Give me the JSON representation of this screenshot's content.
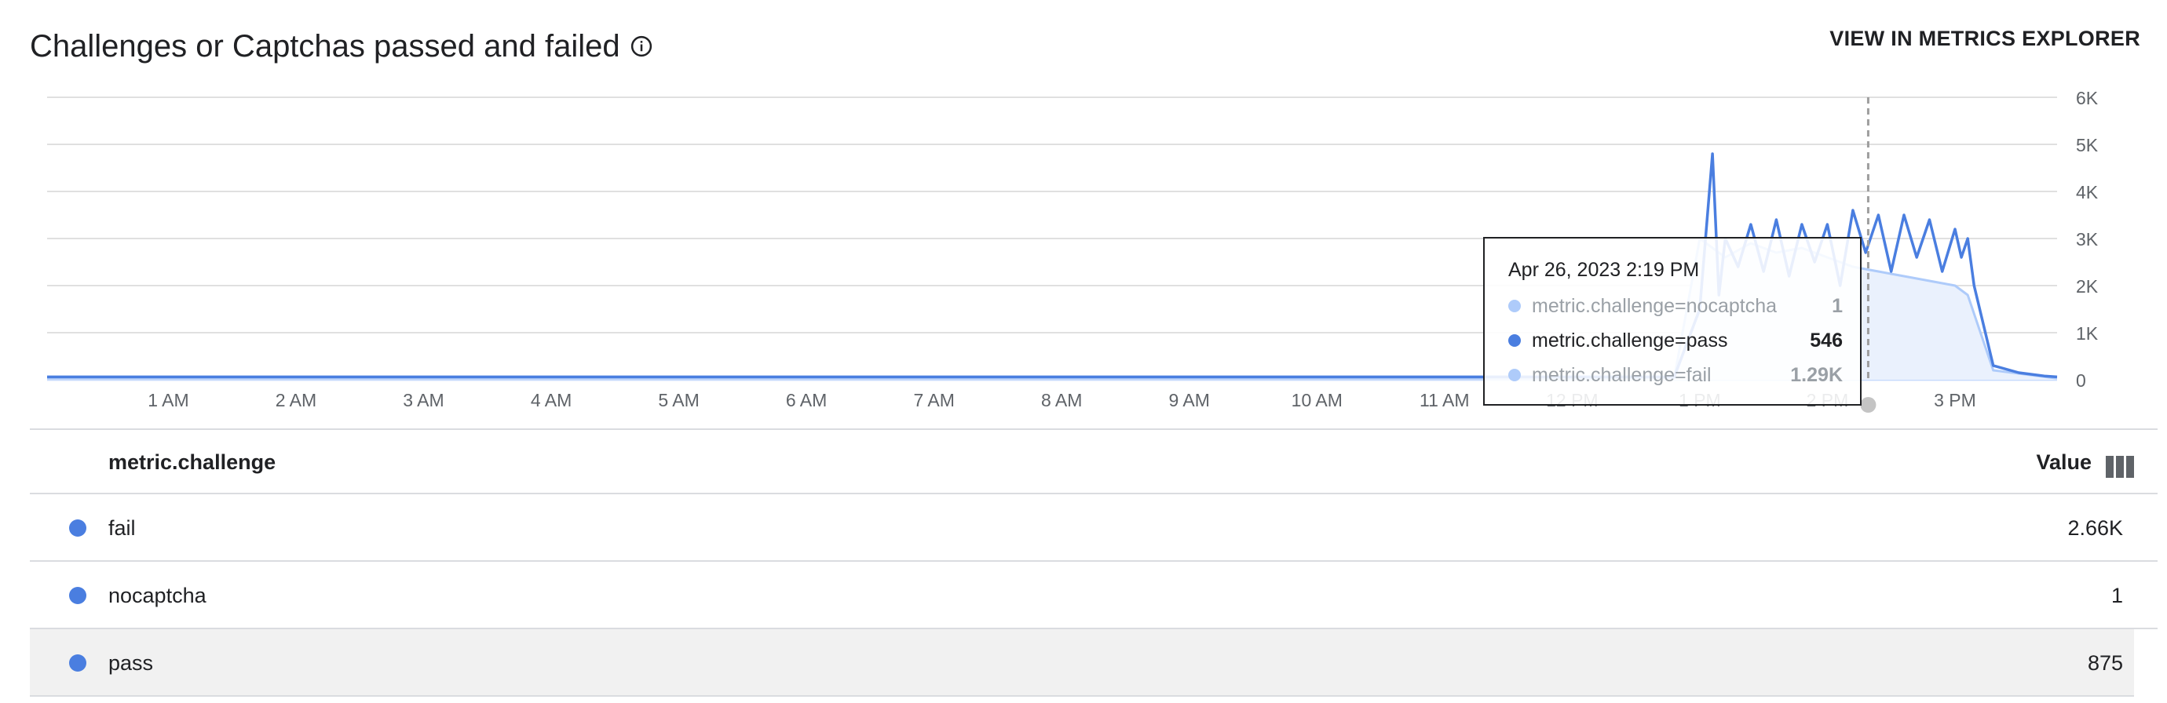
{
  "header": {
    "title": "Challenges or Captchas passed and failed",
    "explorer_link": "VIEW IN METRICS EXPLORER"
  },
  "chart_data": {
    "type": "line",
    "title": "Challenges or Captchas passed and failed",
    "x_ticks": [
      "1 AM",
      "2 AM",
      "3 AM",
      "4 AM",
      "5 AM",
      "6 AM",
      "7 AM",
      "8 AM",
      "9 AM",
      "10 AM",
      "11 AM",
      "12 PM",
      "1 PM",
      "2 PM",
      "3 PM"
    ],
    "y_ticks": [
      "0",
      "1K",
      "2K",
      "3K",
      "4K",
      "5K",
      "6K"
    ],
    "ylim": [
      0,
      6000
    ],
    "xlim_hours": [
      0.05,
      15.8
    ],
    "grid": true,
    "cursor_time_hours": 14.32,
    "series": [
      {
        "name": "metric.challenge=pass",
        "color": "#4a7ee0",
        "x_hours": [
          0.05,
          1,
          2,
          3,
          4,
          5,
          6,
          7,
          8,
          9,
          10,
          11,
          12,
          12.8,
          13.0,
          13.1,
          13.15,
          13.2,
          13.3,
          13.4,
          13.5,
          13.6,
          13.7,
          13.8,
          13.9,
          14.0,
          14.1,
          14.2,
          14.3,
          14.4,
          14.5,
          14.6,
          14.7,
          14.8,
          14.9,
          15.0,
          15.05,
          15.1,
          15.15,
          15.3,
          15.5,
          15.7,
          15.8
        ],
        "values": [
          60,
          60,
          60,
          60,
          60,
          60,
          60,
          60,
          60,
          60,
          60,
          60,
          60,
          60,
          1500,
          4800,
          1800,
          3000,
          2400,
          3300,
          2300,
          3400,
          2200,
          3300,
          2500,
          3300,
          2000,
          3600,
          2700,
          3500,
          2300,
          3500,
          2600,
          3400,
          2300,
          3200,
          2600,
          3000,
          2000,
          300,
          150,
          80,
          60
        ]
      },
      {
        "name": "metric.challenge=fail",
        "color": "#aecbfa",
        "x_hours": [
          0.05,
          12,
          12.8,
          13.0,
          13.2,
          13.4,
          13.6,
          13.8,
          14.0,
          14.2,
          14.4,
          14.6,
          14.8,
          15.0,
          15.1,
          15.3,
          15.8
        ],
        "values": [
          30,
          30,
          40,
          3000,
          2600,
          2900,
          2700,
          2800,
          2600,
          2400,
          2300,
          2200,
          2100,
          2000,
          1800,
          200,
          30
        ]
      },
      {
        "name": "metric.challenge=nocaptcha",
        "color": "#c6dafc",
        "x_hours": [
          0.05,
          15.8
        ],
        "values": [
          1,
          1
        ]
      }
    ]
  },
  "tooltip": {
    "date": "Apr 26, 2023 2:19 PM",
    "rows": [
      {
        "label": "metric.challenge=nocaptcha",
        "value": "1"
      },
      {
        "label": "metric.challenge=pass",
        "value": "546"
      },
      {
        "label": "metric.challenge=fail",
        "value": "1.29K"
      }
    ]
  },
  "table": {
    "headers": {
      "metric": "metric.challenge",
      "value": "Value"
    },
    "rows": [
      {
        "name": "fail",
        "value": "2.66K"
      },
      {
        "name": "nocaptcha",
        "value": "1"
      },
      {
        "name": "pass",
        "value": "875"
      }
    ]
  },
  "icons": {
    "info": "info-icon",
    "columns": "column-picker-icon"
  }
}
